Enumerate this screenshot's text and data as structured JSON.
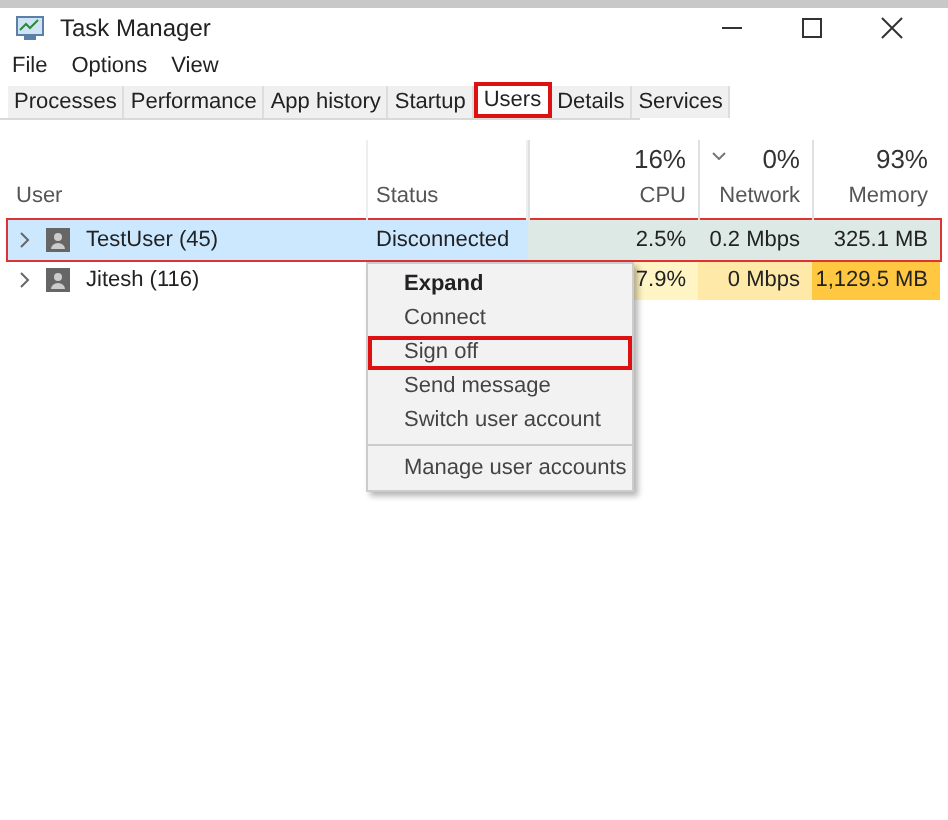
{
  "window": {
    "title": "Task Manager"
  },
  "menu_bar": [
    "File",
    "Options",
    "View"
  ],
  "tabs": [
    {
      "label": "Processes",
      "selected": false,
      "highlighted": false
    },
    {
      "label": "Performance",
      "selected": false,
      "highlighted": false
    },
    {
      "label": "App history",
      "selected": false,
      "highlighted": false
    },
    {
      "label": "Startup",
      "selected": false,
      "highlighted": false
    },
    {
      "label": "Users",
      "selected": true,
      "highlighted": true
    },
    {
      "label": "Details",
      "selected": false,
      "highlighted": false
    },
    {
      "label": "Services",
      "selected": false,
      "highlighted": false
    }
  ],
  "table": {
    "columns": [
      {
        "label": "User"
      },
      {
        "label": "Status"
      },
      {
        "label": "CPU",
        "total": "16%"
      },
      {
        "label": "Network",
        "total": "0%",
        "sorted": true
      },
      {
        "label": "Memory",
        "total": "93%"
      }
    ],
    "rows": [
      {
        "selected": true,
        "highlighted": true,
        "cells": [
          {
            "text": "TestUser (45)"
          },
          {
            "text": "Disconnected"
          },
          {
            "text": "2.5%",
            "color": "#dce9e4"
          },
          {
            "text": "0.2 Mbps",
            "color": "#dce9e4"
          },
          {
            "text": "325.1 MB",
            "color": "#dce9e4"
          }
        ]
      },
      {
        "selected": false,
        "highlighted": false,
        "cells": [
          {
            "text": "Jitesh (116)"
          },
          {
            "text": ""
          },
          {
            "text": "7.9%",
            "color": "#fff4c4"
          },
          {
            "text": "0 Mbps",
            "color": "#ffe9a8"
          },
          {
            "text": "1,129.5 MB",
            "color": "#ffc840"
          }
        ]
      }
    ]
  },
  "context_menu": {
    "groups": [
      [
        {
          "label": "Expand",
          "default": true,
          "highlighted": false
        },
        {
          "label": "Connect",
          "default": false,
          "highlighted": false
        },
        {
          "label": "Sign off",
          "default": false,
          "highlighted": true
        },
        {
          "label": "Send message",
          "default": false,
          "highlighted": false
        },
        {
          "label": "Switch user account",
          "default": false,
          "highlighted": false
        }
      ],
      [
        {
          "label": "Manage user accounts",
          "default": false,
          "highlighted": false
        }
      ]
    ]
  }
}
